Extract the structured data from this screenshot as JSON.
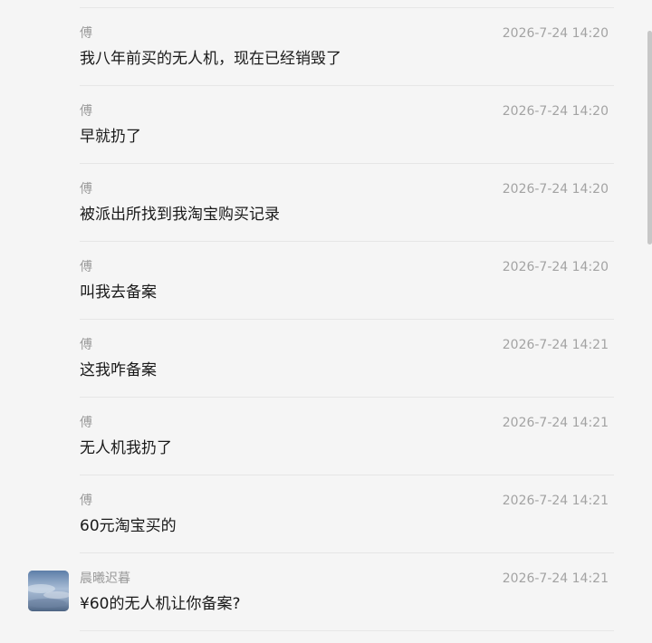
{
  "messages": [
    {
      "sender": "傅",
      "time": "2026-7-24 14:20",
      "text": "我八年前买的无人机，现在已经销毁了",
      "has_avatar": false
    },
    {
      "sender": "傅",
      "time": "2026-7-24 14:20",
      "text": "早就扔了",
      "has_avatar": false
    },
    {
      "sender": "傅",
      "time": "2026-7-24 14:20",
      "text": "被派出所找到我淘宝购买记录",
      "has_avatar": false
    },
    {
      "sender": "傅",
      "time": "2026-7-24 14:20",
      "text": "叫我去备案",
      "has_avatar": false
    },
    {
      "sender": "傅",
      "time": "2026-7-24 14:21",
      "text": "这我咋备案",
      "has_avatar": false
    },
    {
      "sender": "傅",
      "time": "2026-7-24 14:21",
      "text": "无人机我扔了",
      "has_avatar": false
    },
    {
      "sender": "傅",
      "time": "2026-7-24 14:21",
      "text": "60元淘宝买的",
      "has_avatar": false
    },
    {
      "sender": "晨曦迟暮",
      "time": "2026-7-24 14:21",
      "text": "¥60的无人机让你备案?",
      "has_avatar": true
    }
  ]
}
